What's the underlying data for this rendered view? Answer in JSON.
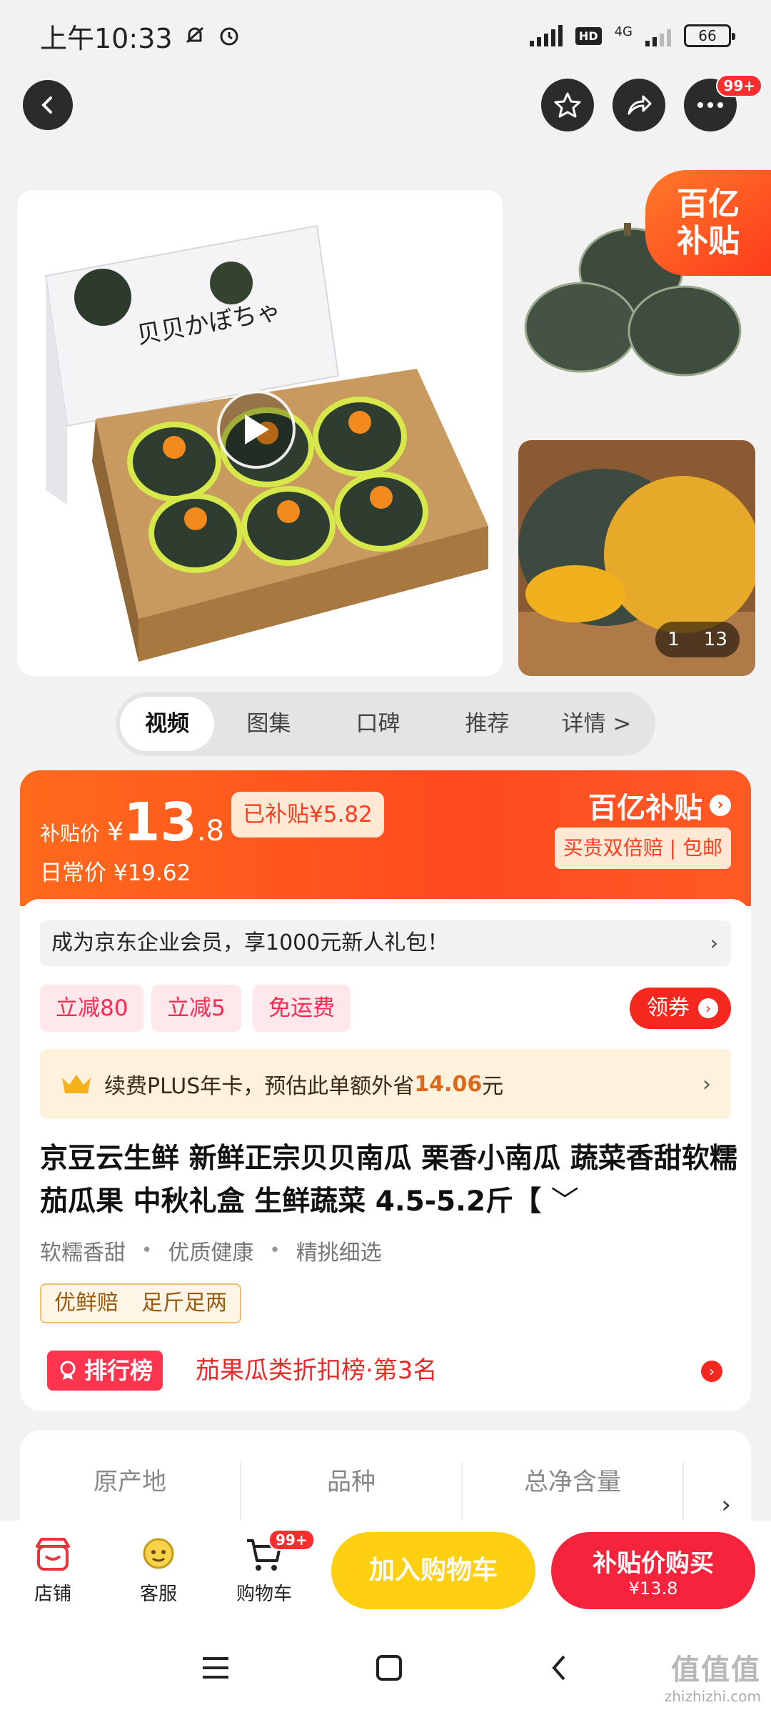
{
  "status": {
    "time": "上午10:33",
    "network": "4G",
    "hd": "HD",
    "battery": "66"
  },
  "nav": {
    "more_badge": "99+"
  },
  "gallery": {
    "subsidy_tag_line1": "百亿",
    "subsidy_tag_line2": "补贴",
    "current_page": "1",
    "total_pages": "13"
  },
  "tabs": [
    {
      "label": "视频"
    },
    {
      "label": "图集"
    },
    {
      "label": "口碑"
    },
    {
      "label": "推荐"
    },
    {
      "label": "详情 >"
    }
  ],
  "price": {
    "label": "补贴价",
    "currency": "¥",
    "integer": "13",
    "decimal": ".8",
    "saved_tag": "已补贴¥5.82",
    "daily_label": "日常价",
    "daily_price": "¥19.62",
    "band_title": "百亿补贴",
    "band_pill": "买贵双倍赔 | 包邮"
  },
  "info": {
    "member_text": "成为京东企业会员，享1000元新人礼包！",
    "coupons": [
      "立减80",
      "立减5",
      "免运费"
    ],
    "get_coupon": "领券",
    "plus_text": "续费PLUS年卡，预估此单额外省",
    "plus_amount": "14.06",
    "plus_unit": "元",
    "product_title": "京豆云生鲜 新鲜正宗贝贝南瓜 栗香小南瓜 蔬菜香甜软糯茄瓜果 中秋礼盒 生鲜蔬菜 4.5-5.2斤【",
    "tags": [
      "软糯香甜",
      "优质健康",
      "精挑细选"
    ],
    "fresh_tags": [
      "优鲜赔",
      "足斤足两"
    ],
    "rank_label": "排行榜",
    "rank_text": "茄果瓜类折扣榜·第3名"
  },
  "specs": [
    {
      "label": "原产地"
    },
    {
      "label": "品种"
    },
    {
      "label": "总净含量"
    }
  ],
  "bottom": {
    "store": "店铺",
    "service": "客服",
    "cart": "购物车",
    "cart_badge": "99+",
    "add_cart": "加入购物车",
    "buy_now": "补贴价购买",
    "buy_now_price": "¥13.8"
  },
  "watermark": {
    "big": "值值值",
    "small": "zhizhizhi.com"
  }
}
